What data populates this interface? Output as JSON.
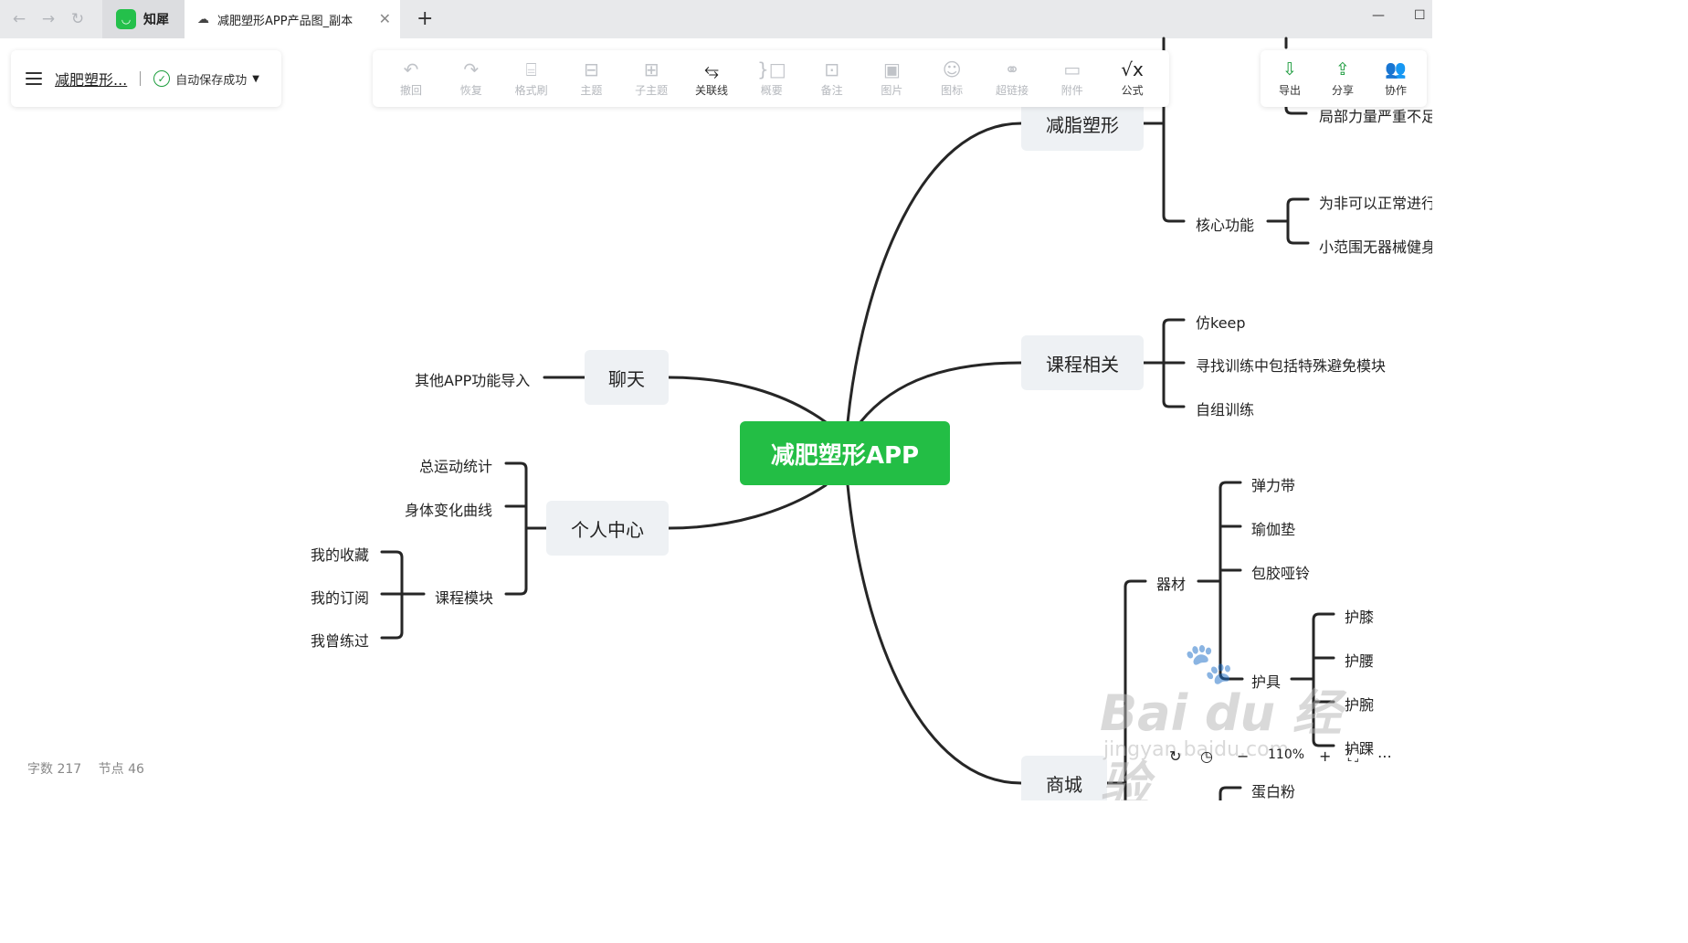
{
  "browser": {
    "nav": {
      "back": "←",
      "forward": "→",
      "reload": "↻"
    },
    "app_tab": "知犀",
    "doc_tab": "减肥塑形APP产品图_副本",
    "close": "✕",
    "new_tab": "+",
    "minimize": "—",
    "maximize": "☐"
  },
  "doc": {
    "title": "减肥塑形...",
    "save_status": "自动保存成功"
  },
  "toolbar": [
    {
      "icon": "undo-icon",
      "glyph": "↶",
      "label": "撤回",
      "active": false
    },
    {
      "icon": "redo-icon",
      "glyph": "↷",
      "label": "恢复",
      "active": false
    },
    {
      "icon": "format-brush-icon",
      "glyph": "⌸",
      "label": "格式刷",
      "active": false
    },
    {
      "icon": "topic-icon",
      "glyph": "⊟",
      "label": "主题",
      "active": false
    },
    {
      "icon": "subtopic-icon",
      "glyph": "⊞",
      "label": "子主题",
      "active": false
    },
    {
      "icon": "relation-line-icon",
      "glyph": "⥃",
      "label": "关联线",
      "active": true
    },
    {
      "icon": "summary-icon",
      "glyph": "}□",
      "label": "概要",
      "active": false
    },
    {
      "icon": "note-icon",
      "glyph": "⊡",
      "label": "备注",
      "active": false
    },
    {
      "icon": "image-icon",
      "glyph": "▣",
      "label": "图片",
      "active": false
    },
    {
      "icon": "emoji-icon",
      "glyph": "☺",
      "label": "图标",
      "active": false
    },
    {
      "icon": "link-icon",
      "glyph": "⚭",
      "label": "超链接",
      "active": false
    },
    {
      "icon": "attachment-icon",
      "glyph": "▭",
      "label": "附件",
      "active": false
    },
    {
      "icon": "formula-icon",
      "glyph": "√x",
      "label": "公式",
      "active": true
    }
  ],
  "right_tools": [
    {
      "icon": "export-icon",
      "glyph": "⇩",
      "label": "导出"
    },
    {
      "icon": "share-icon",
      "glyph": "⇪",
      "label": "分享"
    },
    {
      "icon": "collaborate-icon",
      "glyph": "👥",
      "label": "协作"
    }
  ],
  "mindmap": {
    "root": "减肥塑形APP",
    "branches": {
      "fat_loss": "减脂塑形",
      "course": "课程相关",
      "chat": "聊天",
      "personal": "个人中心",
      "shop": "商城"
    },
    "leaves": {
      "local_strength": "局部力量严重不足",
      "core_function": "核心功能",
      "for_nonnormal": "为非可以正常进行",
      "small_range": "小范围无器械健身",
      "keep": "仿keep",
      "find_training": "寻找训练中包括特殊避免模块",
      "self_training": "自组训练",
      "other_app": "其他APP功能导入",
      "total_stats": "总运动统计",
      "body_curve": "身体变化曲线",
      "course_module": "课程模块",
      "my_fav": "我的收藏",
      "my_sub": "我的订阅",
      "my_practiced": "我曾练过",
      "equipment": "器材",
      "band": "弹力带",
      "yoga_mat": "瑜伽垫",
      "dumbbell": "包胶哑铃",
      "protector": "护具",
      "knee": "护膝",
      "waist": "护腰",
      "wrist": "护腕",
      "ankle": "护踝",
      "protein": "蛋白粉"
    }
  },
  "status": {
    "words": "字数 217",
    "nodes": "节点 46"
  },
  "zoom": {
    "value": "110%",
    "minus": "−",
    "plus": "+"
  },
  "watermark": {
    "brand": "Bai du 经验",
    "url": "jingyan.baidu.com"
  }
}
